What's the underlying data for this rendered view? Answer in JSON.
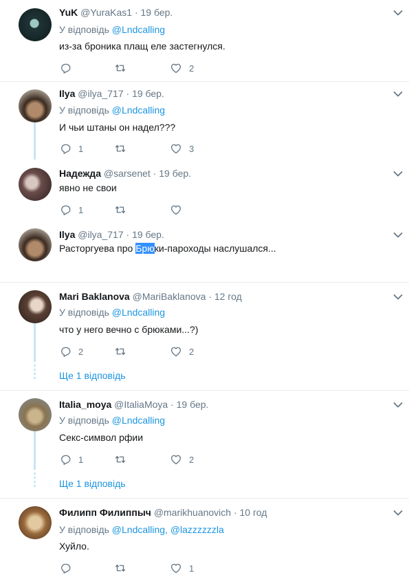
{
  "tweets": [
    {
      "name": "YuK",
      "handle": "@YuraKas1",
      "date": "· 19 бер.",
      "reply_prefix": "У відповідь",
      "reply_to": "@Lndcalling",
      "text": "из-за броника плащ еле застегнулся.",
      "replies": "",
      "retweets": "",
      "likes": "2"
    },
    {
      "name": "Ilya",
      "handle": "@ilya_717",
      "date": "· 19 бер.",
      "reply_prefix": "У відповідь",
      "reply_to": "@Lndcalling",
      "text": "И чьи штаны он надел???",
      "replies": "1",
      "retweets": "",
      "likes": "3"
    },
    {
      "name": "Надежда",
      "handle": "@sarsenet",
      "date": "· 19 бер.",
      "text": "явно не свои",
      "replies": "1",
      "retweets": "",
      "likes": ""
    },
    {
      "name": "Ilya",
      "handle": "@ilya_717",
      "date": "· 19 бер.",
      "text_pre": "Расторгуева про ",
      "text_hl": "Брю",
      "text_post": "ки-пароходы наслушался..."
    },
    {
      "name": "Mari Baklanova",
      "handle": "@MariBaklanova",
      "date": "· 12 год",
      "reply_prefix": "У відповідь",
      "reply_to": "@Lndcalling",
      "text": "что у него вечно с брюками...?)",
      "replies": "2",
      "retweets": "",
      "likes": "2",
      "more": "Ще 1 відповідь"
    },
    {
      "name": "Italia_moya",
      "handle": "@ItaliaMoya",
      "date": "· 19 бер.",
      "reply_prefix": "У відповідь",
      "reply_to": "@Lndcalling",
      "text": "Секс-символ рфии",
      "replies": "1",
      "retweets": "",
      "likes": "2",
      "more": "Ще 1 відповідь"
    },
    {
      "name": "Филипп Филиппыч",
      "handle": "@marikhuanovich",
      "date": "· 10 год",
      "reply_prefix": "У відповідь",
      "reply_to": "@Lndcalling,",
      "reply_to2": "@lazzzzzzla",
      "text": "Хуйло.",
      "replies": "",
      "retweets": "",
      "likes": "1"
    }
  ],
  "icons": {
    "reply": "reply-icon",
    "retweet": "retweet-icon",
    "like": "heart-icon",
    "menu": "chevron-down-icon"
  },
  "colors": {
    "link": "#1b95e0",
    "thread_line": "#c4e6f5",
    "muted": "#657786",
    "highlight": "#3390ff"
  }
}
